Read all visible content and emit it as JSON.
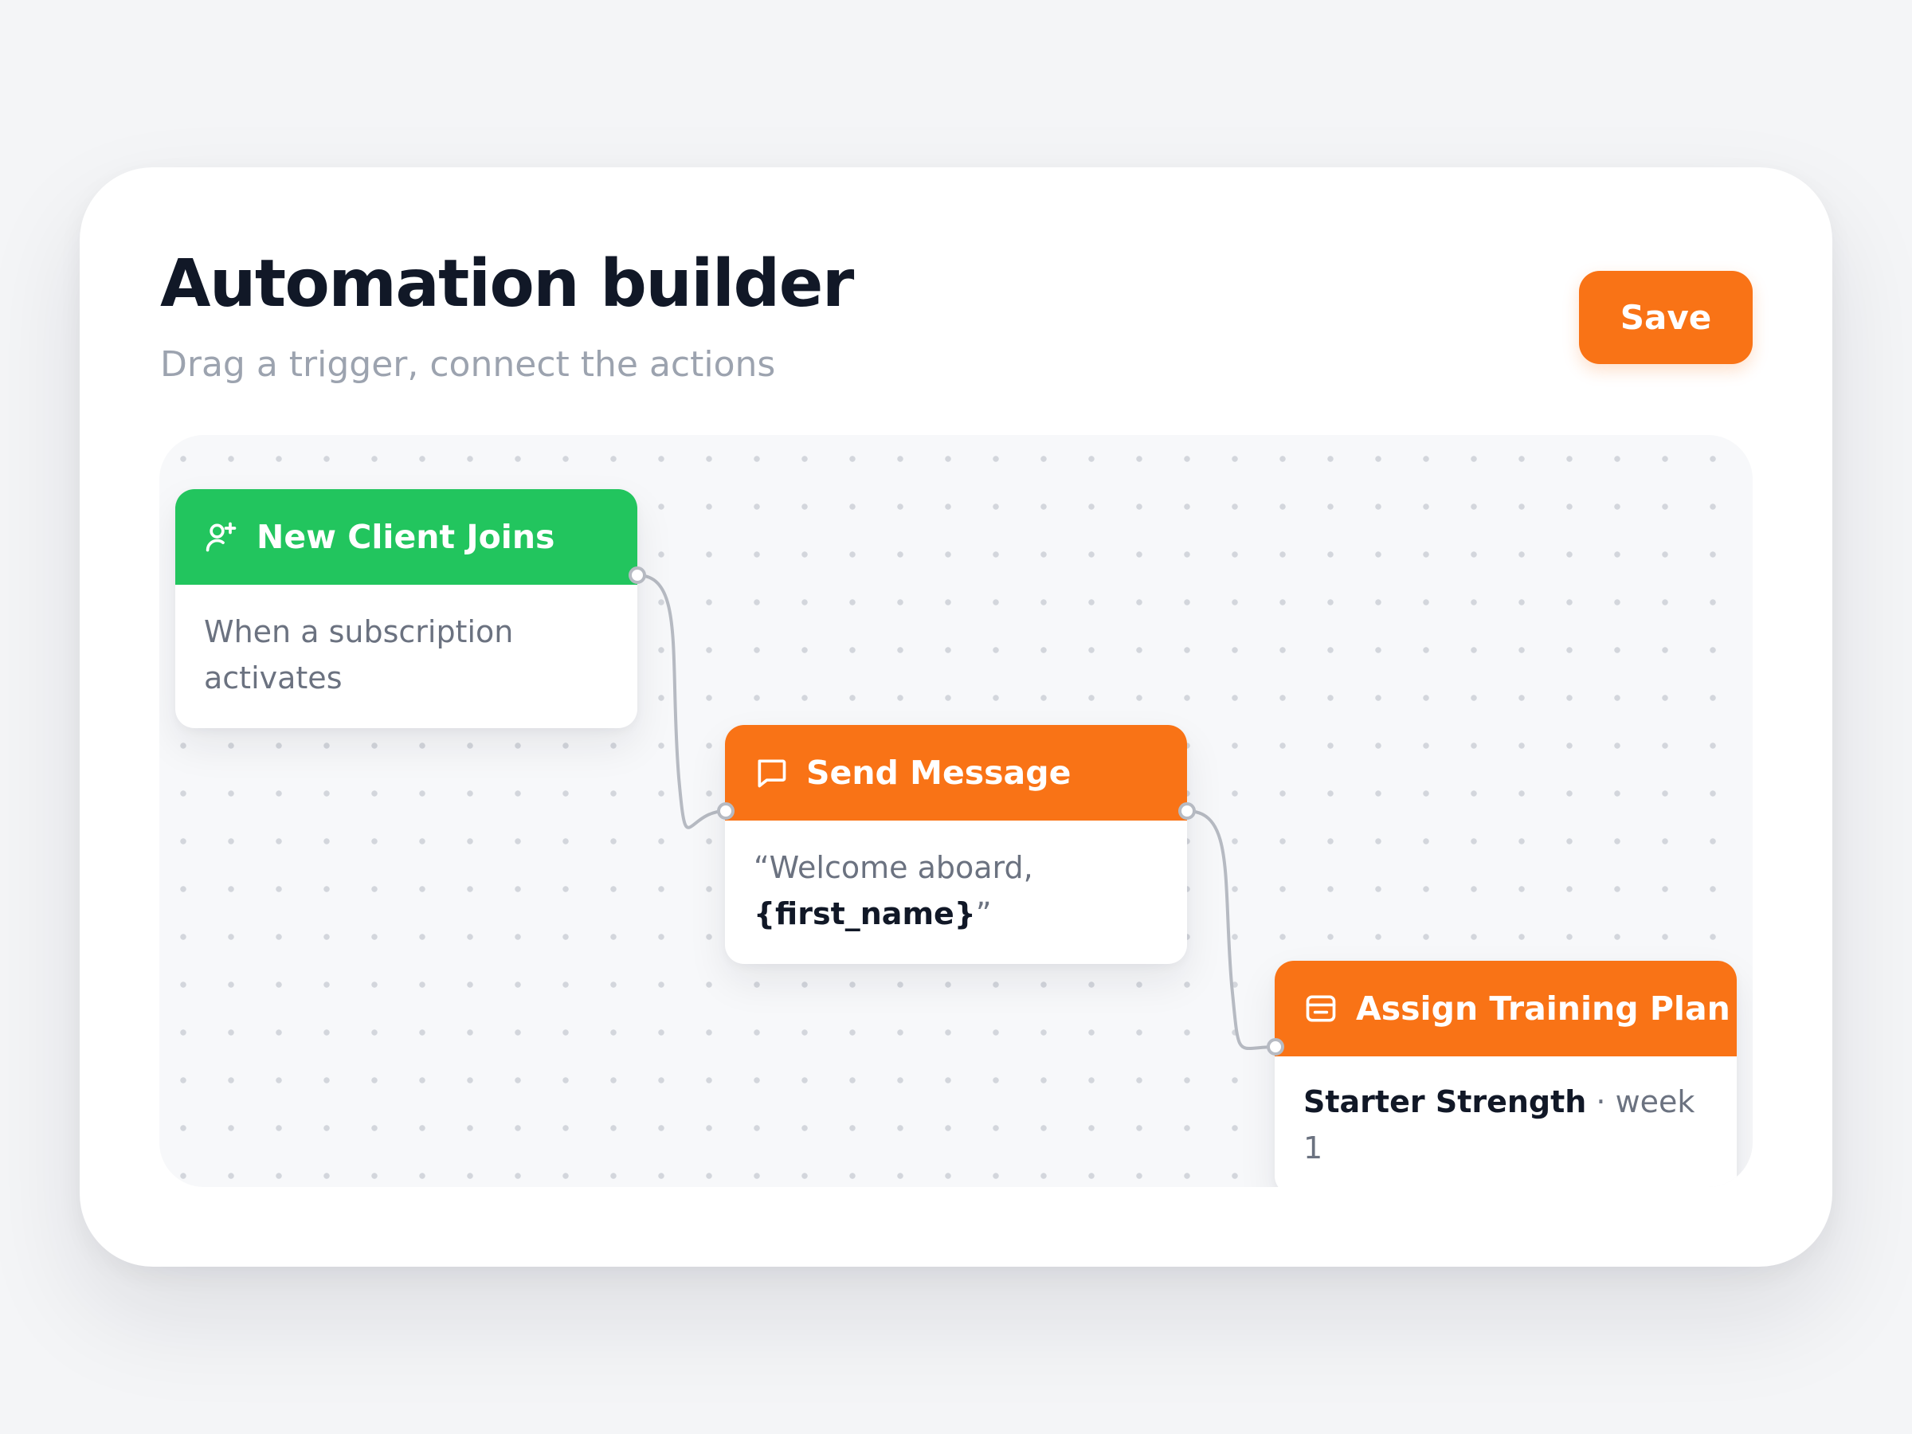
{
  "header": {
    "title": "Automation builder",
    "subtitle": "Drag a trigger, connect the actions",
    "save_label": "Save"
  },
  "nodes": {
    "trigger": {
      "icon": "user-plus-icon",
      "title": "New Client Joins",
      "description": "When a subscription activates",
      "color": "#22c55e"
    },
    "message": {
      "icon": "message-icon",
      "title": "Send Message",
      "quote_open": "“Welcome aboard, ",
      "variable": "{first_name}",
      "quote_close": "”",
      "color": "#f97316"
    },
    "plan": {
      "icon": "plan-icon",
      "title": "Assign Training Plan",
      "plan_name": "Starter Strength",
      "plan_detail": " · week 1",
      "color": "#f97316"
    }
  }
}
